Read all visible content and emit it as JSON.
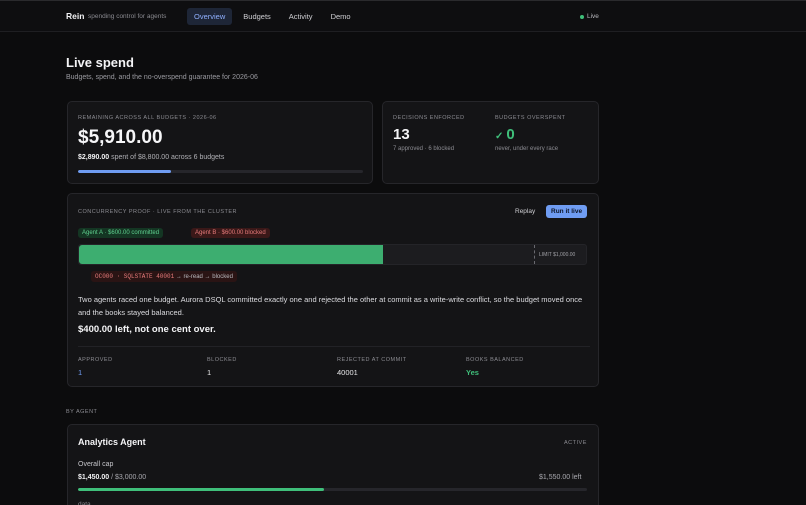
{
  "header": {
    "brand": "Rein",
    "tagline": "spending control for agents",
    "nav": [
      {
        "label": "Overview",
        "active": true
      },
      {
        "label": "Budgets",
        "active": false
      },
      {
        "label": "Activity",
        "active": false
      },
      {
        "label": "Demo",
        "active": false
      }
    ],
    "live_label": "Live"
  },
  "page": {
    "title": "Live spend",
    "subtitle": "Budgets, spend, and the no-overspend guarantee for 2026-06"
  },
  "remaining": {
    "label": "REMAINING ACROSS ALL BUDGETS · 2026-06",
    "amount": "$5,910.00",
    "spent": "$2,890.00",
    "spent_rest": " spent of $8,800.00 across 6 budgets",
    "progress_fraction": 0.328
  },
  "decisions": {
    "label": "DECISIONS ENFORCED",
    "value": "13",
    "detail": "7 approved · 6 blocked"
  },
  "overspent": {
    "label": "BUDGETS OVERSPENT",
    "value": "0",
    "detail": "never, under every race"
  },
  "concurrency": {
    "title": "CONCURRENCY PROOF · LIVE FROM THE CLUSTER",
    "replay_label": "Replay",
    "run_label": "Run it live",
    "agent_a": "Agent A · $600.00 committed",
    "agent_b": "Agent B · $600.00 blocked",
    "committed_fraction": 0.6,
    "limit_label": "LIMIT $1,000.00",
    "error_code": "OC000 · SQLSTATE 40001",
    "error_rest": " → re-read → blocked",
    "paragraph": "Two agents raced one budget. Aurora DSQL committed exactly one and rejected the other at commit as a write-write conflict, so the budget moved once and the books stayed balanced.",
    "summary": "$400.00 left, not one cent over.",
    "stats": [
      {
        "label": "APPROVED",
        "value": "1"
      },
      {
        "label": "BLOCKED",
        "value": "1"
      },
      {
        "label": "REJECTED AT COMMIT",
        "value": "40001"
      },
      {
        "label": "BOOKS BALANCED",
        "value": "Yes"
      }
    ]
  },
  "by_agent": {
    "label": "BY AGENT",
    "agents": [
      {
        "name": "Analytics Agent",
        "status": "ACTIVE",
        "cap_label": "Overall cap",
        "spent": "$1,450.00",
        "cap": " / $3,000.00",
        "left": "$1,550.00 left",
        "progress_fraction": 0.483,
        "sub_label": "data"
      }
    ]
  },
  "colors": {
    "accent": "#6f9cf2",
    "success": "#3fbf7a",
    "danger": "#e57a7a"
  }
}
